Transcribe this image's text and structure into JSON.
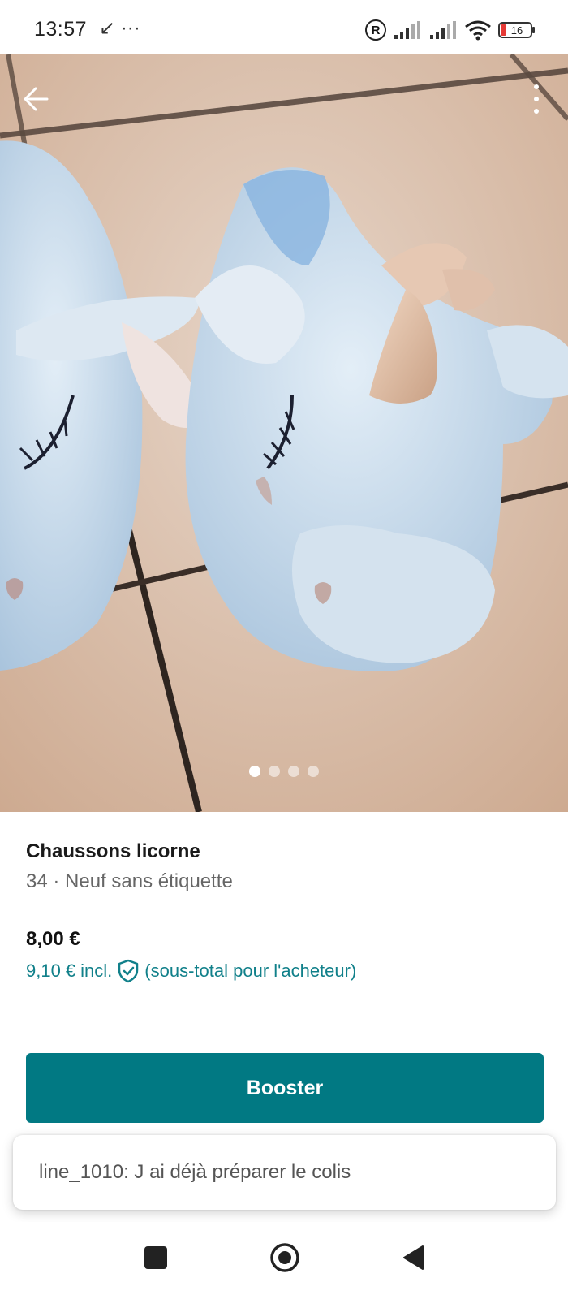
{
  "status_bar": {
    "time": "13:57",
    "left_icons": "↙ ···",
    "battery": "16",
    "icons": [
      "registered-icon",
      "signal-icon",
      "signal-icon",
      "wifi-icon",
      "battery-icon"
    ]
  },
  "hero": {
    "image_count": 4,
    "active_index": 0,
    "icons": {
      "back": "arrow-left-icon",
      "more": "more-vertical-icon"
    }
  },
  "item": {
    "title": "Chaussons licorne",
    "subtitle": "34 · Neuf sans étiquette",
    "price": "8,00 €",
    "price_with_fees": "9,10 €",
    "incl_label": "incl.",
    "buyer_note": "(sous-total pour l'acheteur)"
  },
  "actions": {
    "booster_label": "Booster"
  },
  "toast": {
    "message": "line_1010: J ai déjà préparer le colis"
  },
  "colors": {
    "accent": "#017983",
    "price_teal": "#11808a"
  },
  "nav": {
    "icons": [
      "recents-square-icon",
      "home-circle-icon",
      "back-triangle-icon"
    ]
  }
}
